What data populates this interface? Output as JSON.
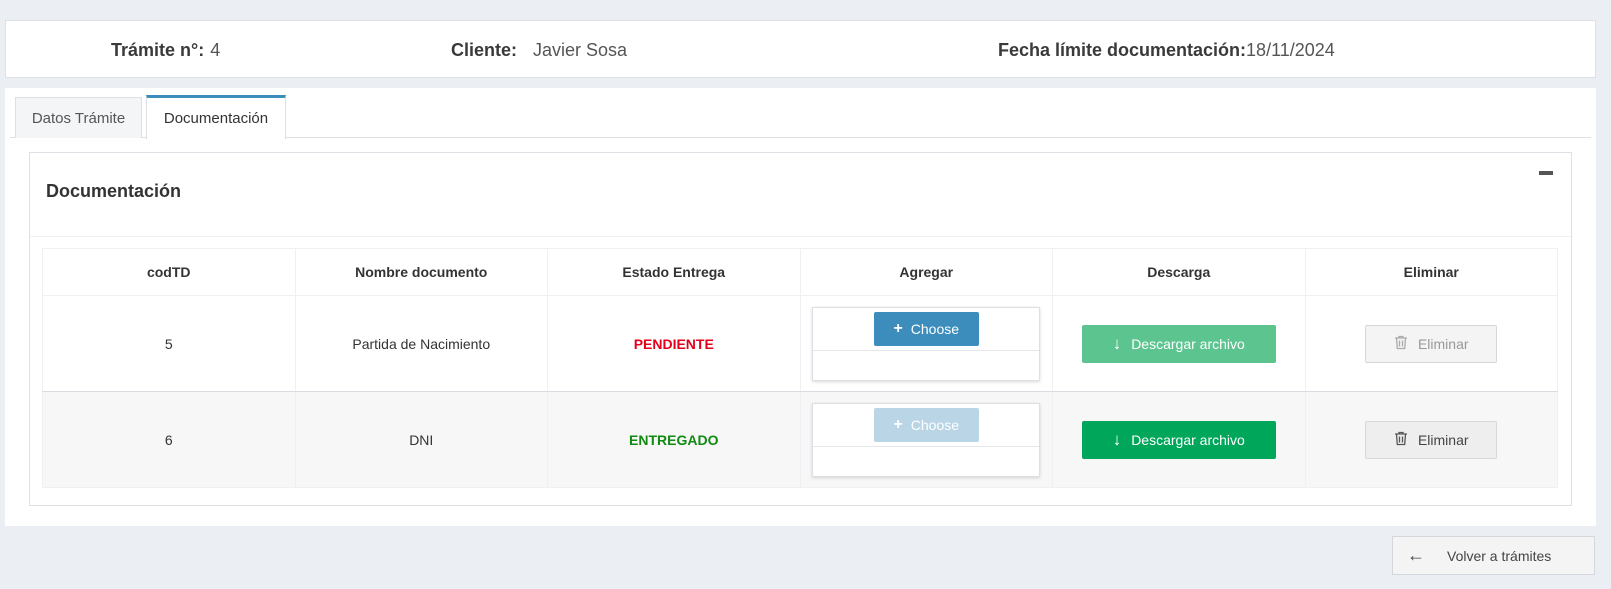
{
  "header": {
    "tramite_label": "Trámite n°:",
    "tramite_value": "4",
    "cliente_label": "Cliente:",
    "cliente_value": "Javier Sosa",
    "fecha_label": "Fecha límite documentación:",
    "fecha_value": "18/11/2024"
  },
  "tabs": [
    {
      "label": "Datos Trámite",
      "active": false
    },
    {
      "label": "Documentación",
      "active": true
    }
  ],
  "box": {
    "title": "Documentación",
    "collapse_icon": "minus-icon"
  },
  "table": {
    "columns": [
      "codTD",
      "Nombre documento",
      "Estado Entrega",
      "Agregar",
      "Descarga",
      "Eliminar"
    ],
    "rows": [
      {
        "codTD": "5",
        "nombre": "Partida de Nacimiento",
        "estado": "PENDIENTE",
        "choose_label": "Choose",
        "choose_enabled": true,
        "download_label": "Descargar archivo",
        "delete_label": "Eliminar",
        "delete_enabled": false
      },
      {
        "codTD": "6",
        "nombre": "DNI",
        "estado": "ENTREGADO",
        "choose_label": "Choose",
        "choose_enabled": false,
        "download_label": "Descargar archivo",
        "delete_label": "Eliminar",
        "delete_enabled": true
      }
    ]
  },
  "colors": {
    "pendiente": "#e3001b",
    "entregado": "#108a10",
    "primary": "#3c8dbc",
    "success": "#00a65a"
  },
  "back_button": {
    "label": "Volver a trámites",
    "icon": "arrow-left-icon"
  }
}
